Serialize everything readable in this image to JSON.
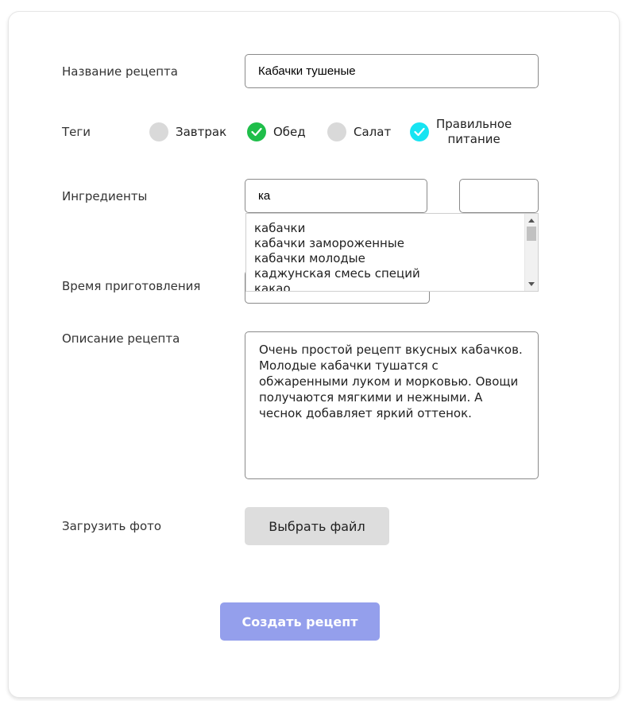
{
  "form": {
    "name_label": "Название рецепта",
    "name_value": "Кабачки тушеные",
    "tags_label": "Теги",
    "tags": [
      {
        "label": "Завтрак",
        "checked": false,
        "color": "#d9d9d9"
      },
      {
        "label": "Обед",
        "checked": true,
        "color": "#1fbe4a"
      },
      {
        "label": "Салат",
        "checked": false,
        "color": "#d9d9d9"
      },
      {
        "label": "Правильное питание",
        "label_line1": "Правильное",
        "label_line2": "питание",
        "checked": true,
        "color": "#17e4f2"
      }
    ],
    "ingredients_label": "Ингредиенты",
    "ingredient_value": "ка",
    "ingredient_amount": "",
    "suggestions": [
      "кабачки",
      "кабачки замороженные",
      "кабачки молодые",
      "каджунская смесь специй",
      "какао"
    ],
    "time_label": "Время приготовления",
    "description_label": "Описание рецепта",
    "description_value": "Очень простой рецепт вкусных кабачков. Молодые кабачки тушатся с обжаренными луком и морковью. Овощи получаются мягкими и нежными. А чеснок добавляет яркий оттенок.",
    "photo_label": "Загрузить фото",
    "file_button": "Выбрать файл",
    "submit_button": "Создать рецепт"
  },
  "colors": {
    "submit": "#949fec",
    "tag_green": "#1fbe4a",
    "tag_cyan": "#17e4f2"
  }
}
